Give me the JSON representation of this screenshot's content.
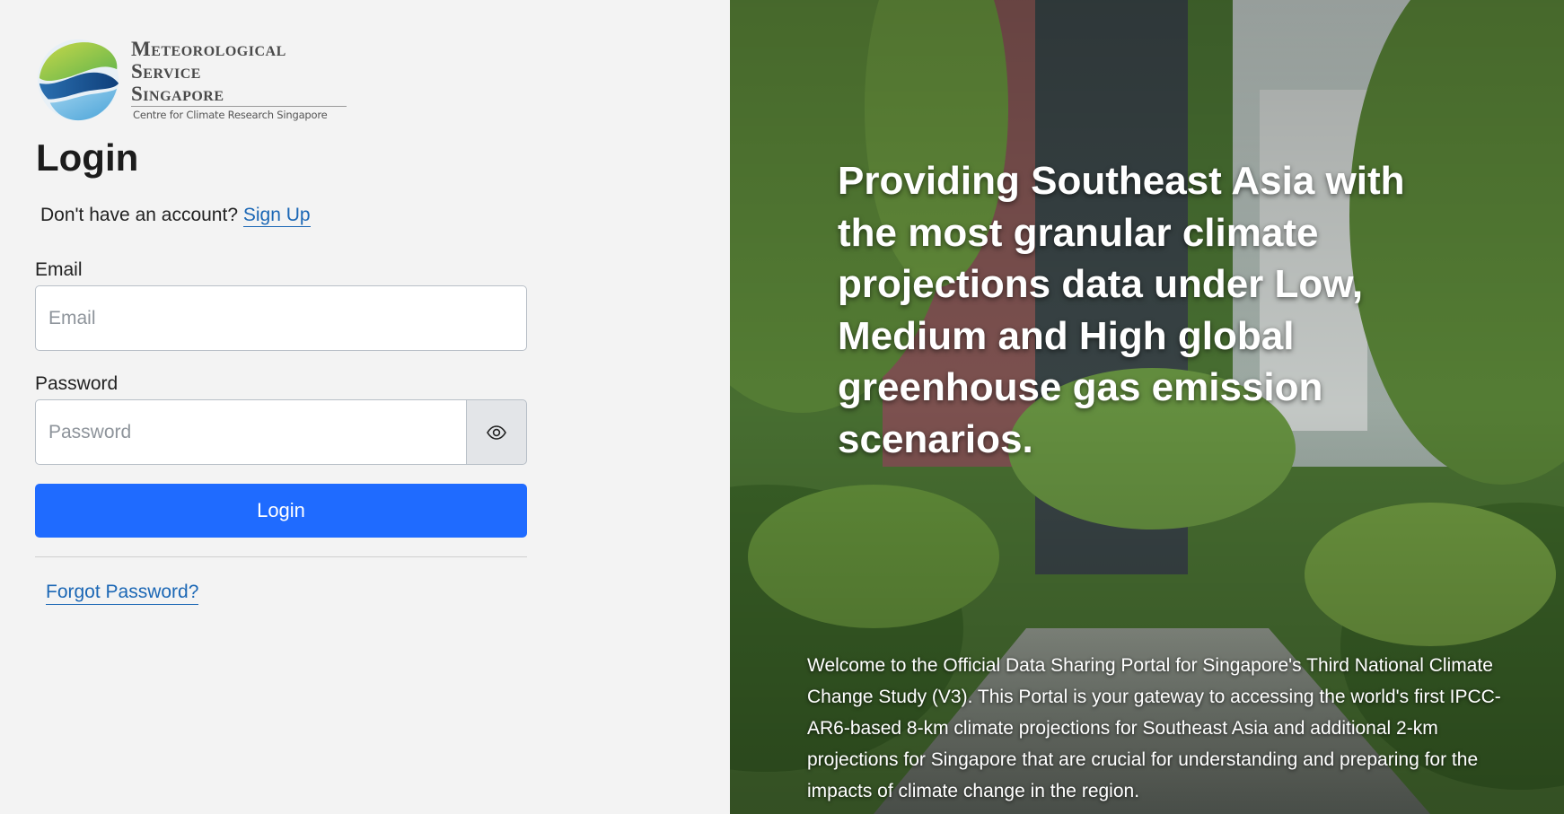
{
  "brand": {
    "name_lines": [
      "Meteorological",
      "Service",
      "Singapore"
    ],
    "subtitle": "Centre for Climate Research Singapore"
  },
  "login": {
    "title": "Login",
    "signup_prompt": "Don't have an account?",
    "signup_link": "Sign Up",
    "email_label": "Email",
    "email_placeholder": "Email",
    "password_label": "Password",
    "password_placeholder": "Password",
    "submit_label": "Login",
    "forgot_link": "Forgot Password?"
  },
  "hero": {
    "headline": "Providing Southeast Asia with the most granular climate projections data under Low, Medium and High global greenhouse gas emission scenarios.",
    "welcome_text": "Welcome to the Official Data Sharing Portal for Singapore's Third National Climate Change Study (V3). This Portal is your gateway to accessing the world's first IPCC-AR6-based 8-km climate projections for Southeast Asia and additional 2-km projections for Singapore that are crucial for understanding and preparing for the impacts of climate change in the region."
  },
  "icons": {
    "eye": "eye-icon",
    "logo": "mss-logo-emblem"
  },
  "colors": {
    "primary_button": "#1f6bff",
    "link": "#1b67b5",
    "page_bg": "#f3f3f3"
  }
}
